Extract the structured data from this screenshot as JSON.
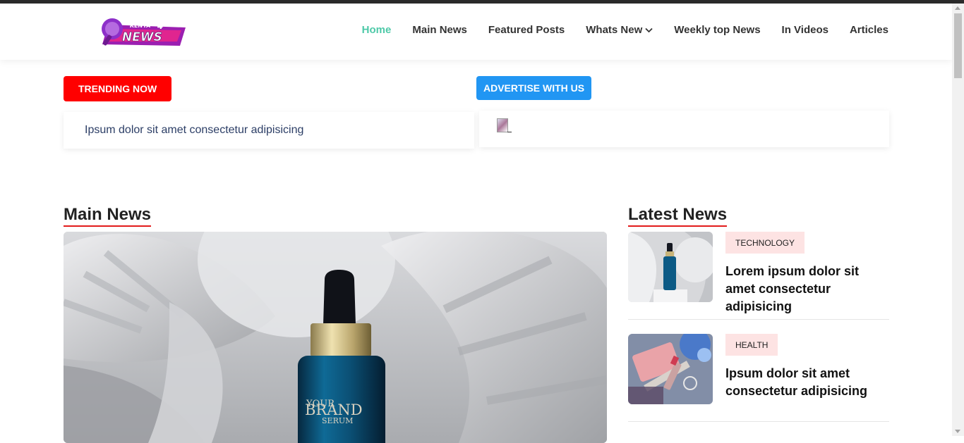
{
  "header": {
    "logo_text_small": "KENYA",
    "logo_text_4": "4",
    "logo_text_big": "NEWS",
    "nav": [
      {
        "label": "Home",
        "active": true
      },
      {
        "label": "Main News"
      },
      {
        "label": "Featured Posts"
      },
      {
        "label": "Whats New",
        "dropdown": true
      },
      {
        "label": "Weekly top News"
      },
      {
        "label": "In Videos"
      },
      {
        "label": "Articles"
      }
    ]
  },
  "trending": {
    "badge": "Trending Now",
    "text": "Ipsum dolor sit amet consectetur adipisicing"
  },
  "advert": {
    "badge": "Advertise With Us"
  },
  "main_news": {
    "title": "Main News",
    "hero_product": {
      "line1": "YOUR",
      "line2": "BRAND",
      "line3": "SERUM"
    }
  },
  "latest_news": {
    "title": "Latest News",
    "items": [
      {
        "tag": "Technology",
        "headline": "Lorem ipsum dolor sit amet consectetur adipisicing"
      },
      {
        "tag": "Health",
        "headline": "Ipsum dolor sit amet consectetur adipisicing"
      }
    ]
  },
  "colors": {
    "accent_active": "#4ec9a8",
    "trending_red": "#ff0000",
    "advert_blue": "#2196f3",
    "underline_red": "#e21b1b",
    "tag_bg": "#fde3e3"
  }
}
